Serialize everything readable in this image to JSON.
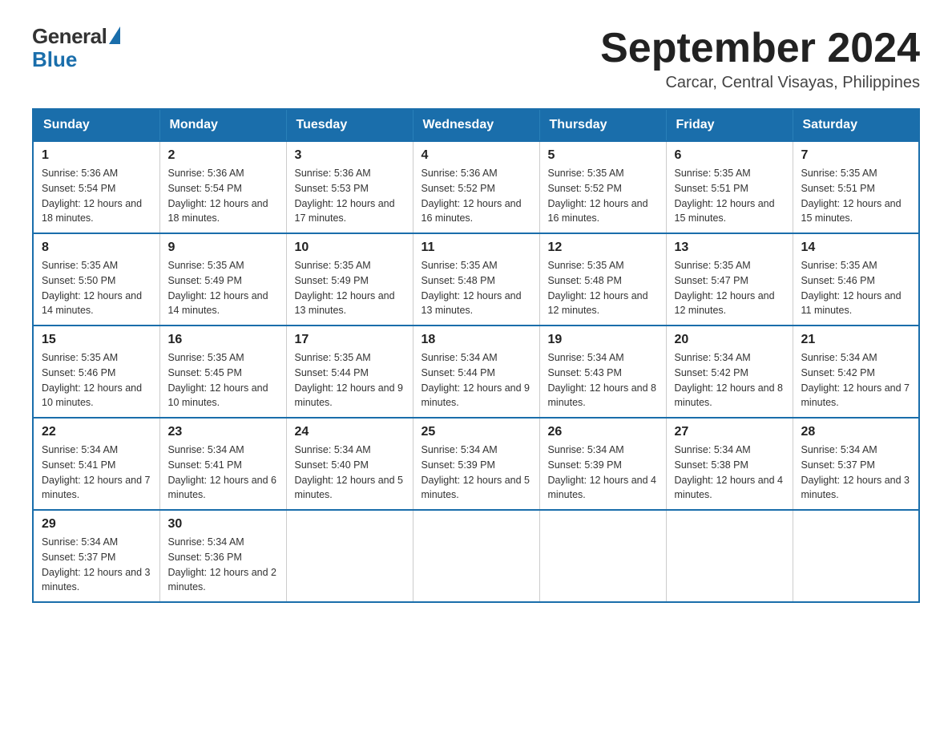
{
  "header": {
    "logo_general": "General",
    "logo_blue": "Blue",
    "title": "September 2024",
    "location": "Carcar, Central Visayas, Philippines"
  },
  "days_of_week": [
    "Sunday",
    "Monday",
    "Tuesday",
    "Wednesday",
    "Thursday",
    "Friday",
    "Saturday"
  ],
  "weeks": [
    [
      {
        "day": "1",
        "sunrise": "5:36 AM",
        "sunset": "5:54 PM",
        "daylight": "12 hours and 18 minutes."
      },
      {
        "day": "2",
        "sunrise": "5:36 AM",
        "sunset": "5:54 PM",
        "daylight": "12 hours and 18 minutes."
      },
      {
        "day": "3",
        "sunrise": "5:36 AM",
        "sunset": "5:53 PM",
        "daylight": "12 hours and 17 minutes."
      },
      {
        "day": "4",
        "sunrise": "5:36 AM",
        "sunset": "5:52 PM",
        "daylight": "12 hours and 16 minutes."
      },
      {
        "day": "5",
        "sunrise": "5:35 AM",
        "sunset": "5:52 PM",
        "daylight": "12 hours and 16 minutes."
      },
      {
        "day": "6",
        "sunrise": "5:35 AM",
        "sunset": "5:51 PM",
        "daylight": "12 hours and 15 minutes."
      },
      {
        "day": "7",
        "sunrise": "5:35 AM",
        "sunset": "5:51 PM",
        "daylight": "12 hours and 15 minutes."
      }
    ],
    [
      {
        "day": "8",
        "sunrise": "5:35 AM",
        "sunset": "5:50 PM",
        "daylight": "12 hours and 14 minutes."
      },
      {
        "day": "9",
        "sunrise": "5:35 AM",
        "sunset": "5:49 PM",
        "daylight": "12 hours and 14 minutes."
      },
      {
        "day": "10",
        "sunrise": "5:35 AM",
        "sunset": "5:49 PM",
        "daylight": "12 hours and 13 minutes."
      },
      {
        "day": "11",
        "sunrise": "5:35 AM",
        "sunset": "5:48 PM",
        "daylight": "12 hours and 13 minutes."
      },
      {
        "day": "12",
        "sunrise": "5:35 AM",
        "sunset": "5:48 PM",
        "daylight": "12 hours and 12 minutes."
      },
      {
        "day": "13",
        "sunrise": "5:35 AM",
        "sunset": "5:47 PM",
        "daylight": "12 hours and 12 minutes."
      },
      {
        "day": "14",
        "sunrise": "5:35 AM",
        "sunset": "5:46 PM",
        "daylight": "12 hours and 11 minutes."
      }
    ],
    [
      {
        "day": "15",
        "sunrise": "5:35 AM",
        "sunset": "5:46 PM",
        "daylight": "12 hours and 10 minutes."
      },
      {
        "day": "16",
        "sunrise": "5:35 AM",
        "sunset": "5:45 PM",
        "daylight": "12 hours and 10 minutes."
      },
      {
        "day": "17",
        "sunrise": "5:35 AM",
        "sunset": "5:44 PM",
        "daylight": "12 hours and 9 minutes."
      },
      {
        "day": "18",
        "sunrise": "5:34 AM",
        "sunset": "5:44 PM",
        "daylight": "12 hours and 9 minutes."
      },
      {
        "day": "19",
        "sunrise": "5:34 AM",
        "sunset": "5:43 PM",
        "daylight": "12 hours and 8 minutes."
      },
      {
        "day": "20",
        "sunrise": "5:34 AM",
        "sunset": "5:42 PM",
        "daylight": "12 hours and 8 minutes."
      },
      {
        "day": "21",
        "sunrise": "5:34 AM",
        "sunset": "5:42 PM",
        "daylight": "12 hours and 7 minutes."
      }
    ],
    [
      {
        "day": "22",
        "sunrise": "5:34 AM",
        "sunset": "5:41 PM",
        "daylight": "12 hours and 7 minutes."
      },
      {
        "day": "23",
        "sunrise": "5:34 AM",
        "sunset": "5:41 PM",
        "daylight": "12 hours and 6 minutes."
      },
      {
        "day": "24",
        "sunrise": "5:34 AM",
        "sunset": "5:40 PM",
        "daylight": "12 hours and 5 minutes."
      },
      {
        "day": "25",
        "sunrise": "5:34 AM",
        "sunset": "5:39 PM",
        "daylight": "12 hours and 5 minutes."
      },
      {
        "day": "26",
        "sunrise": "5:34 AM",
        "sunset": "5:39 PM",
        "daylight": "12 hours and 4 minutes."
      },
      {
        "day": "27",
        "sunrise": "5:34 AM",
        "sunset": "5:38 PM",
        "daylight": "12 hours and 4 minutes."
      },
      {
        "day": "28",
        "sunrise": "5:34 AM",
        "sunset": "5:37 PM",
        "daylight": "12 hours and 3 minutes."
      }
    ],
    [
      {
        "day": "29",
        "sunrise": "5:34 AM",
        "sunset": "5:37 PM",
        "daylight": "12 hours and 3 minutes."
      },
      {
        "day": "30",
        "sunrise": "5:34 AM",
        "sunset": "5:36 PM",
        "daylight": "12 hours and 2 minutes."
      },
      null,
      null,
      null,
      null,
      null
    ]
  ]
}
